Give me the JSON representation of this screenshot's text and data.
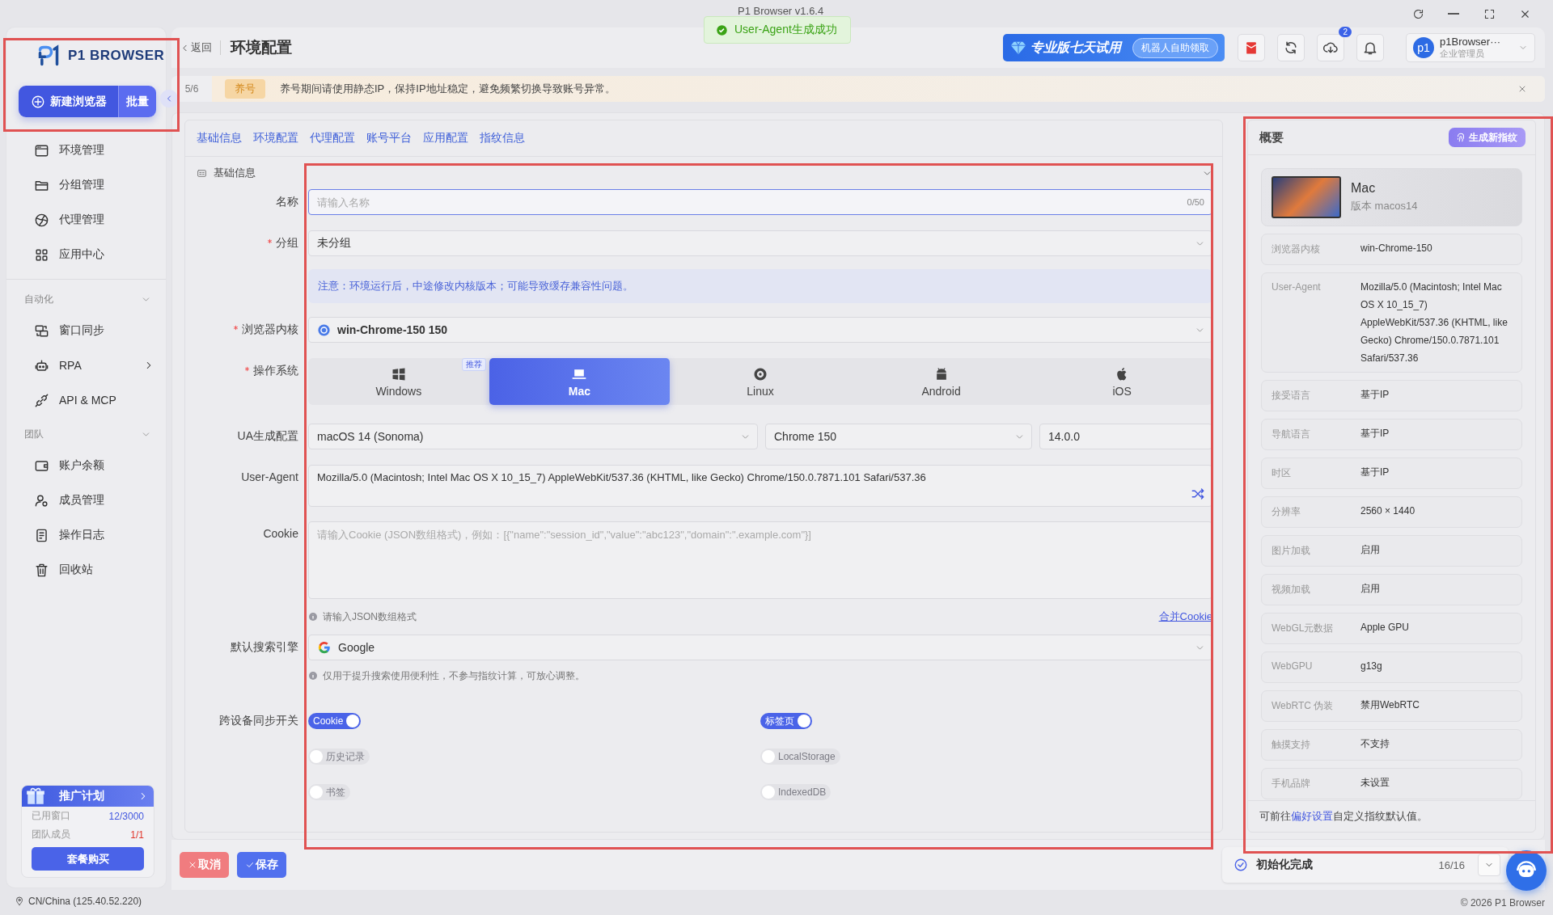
{
  "window": {
    "title": "P1 Browser v1.6.4"
  },
  "toast": {
    "kind": "success",
    "text": "User-Agent生成成功"
  },
  "sidebar": {
    "logo": "P1 BROWSER",
    "new_button": "新建浏览器",
    "batch_button": "批量",
    "sections": [
      {
        "items": [
          {
            "label": "环境管理",
            "selected": false,
            "submenu": false
          },
          {
            "label": "分组管理",
            "selected": false,
            "submenu": false
          },
          {
            "label": "代理管理",
            "selected": false,
            "submenu": false
          },
          {
            "label": "应用中心",
            "selected": false,
            "submenu": false
          }
        ]
      },
      {
        "title": "自动化",
        "expanded": true,
        "items": [
          {
            "label": "窗口同步",
            "selected": false,
            "submenu": false
          },
          {
            "label": "RPA",
            "selected": false,
            "submenu": true
          },
          {
            "label": "API & MCP",
            "selected": false,
            "submenu": false
          }
        ]
      },
      {
        "title": "团队",
        "expanded": true,
        "items": [
          {
            "label": "账户余额",
            "selected": false,
            "submenu": false
          },
          {
            "label": "成员管理",
            "selected": false,
            "submenu": false
          },
          {
            "label": "操作日志",
            "selected": false,
            "submenu": false
          },
          {
            "label": "回收站",
            "selected": false,
            "submenu": false
          }
        ]
      }
    ],
    "promo": {
      "title": "推广计划",
      "rows": [
        {
          "kind": "info",
          "label": "已用窗口",
          "value": "12/3000"
        },
        {
          "kind": "warn",
          "label": "团队成员",
          "value": "1/1"
        }
      ],
      "button": "套餐购买"
    },
    "location": "CN/China (125.40.52.220)"
  },
  "header": {
    "back": "返回",
    "title": "环境配置",
    "trial": "专业版七天试用",
    "trial_button": "机器人自助领取",
    "download_badge": "2",
    "user": {
      "avatar": "p1",
      "name": "p1Browser···",
      "role": "企业管理员"
    }
  },
  "notice": {
    "counter": "5/6",
    "tag": "养号",
    "text": "养号期间请使用静态IP，保持IP地址稳定，避免频繁切换导致账号异常。"
  },
  "tabs": [
    "基础信息",
    "环境配置",
    "代理配置",
    "账号平台",
    "应用配置",
    "指纹信息"
  ],
  "form": {
    "section": "基础信息",
    "name": {
      "label": "名称",
      "required": false,
      "placeholder": "请输入名称",
      "counter": "0/50"
    },
    "group": {
      "label": "分组",
      "required": true,
      "value": "未分组"
    },
    "note": "注意：环境运行后，中途修改内核版本；可能导致缓存兼容性问题。",
    "kernel": {
      "label": "浏览器内核",
      "required": true,
      "value": "win-Chrome-150 150"
    },
    "os": {
      "label": "操作系统",
      "required": true,
      "options": [
        {
          "label": "Windows",
          "selected": false,
          "badge": "推荐"
        },
        {
          "label": "Mac",
          "selected": true
        },
        {
          "label": "Linux",
          "selected": false
        },
        {
          "label": "Android",
          "selected": false
        },
        {
          "label": "iOS",
          "selected": false
        }
      ]
    },
    "ua_config": {
      "label": "UA生成配置",
      "required": false,
      "os": "macOS 14 (Sonoma)",
      "browser": "Chrome 150",
      "version": "14.0.0"
    },
    "user_agent": {
      "label": "User-Agent",
      "required": false,
      "value": "Mozilla/5.0 (Macintosh; Intel Mac OS X 10_15_7) AppleWebKit/537.36 (KHTML, like Gecko) Chrome/150.0.7871.101 Safari/537.36"
    },
    "cookie": {
      "label": "Cookie",
      "required": false,
      "placeholder": "请输入Cookie (JSON数组格式)，例如：[{\"name\":\"session_id\",\"value\":\"abc123\",\"domain\":\".example.com\"}]",
      "hint": "请输入JSON数组格式",
      "merge_link": "合并Cookie"
    },
    "search_engine": {
      "label": "默认搜索引擎",
      "required": false,
      "value": "Google",
      "hint": "仅用于提升搜索使用便利性，不参与指纹计算，可放心调整。"
    },
    "sync": {
      "label": "跨设备同步开关",
      "toggles": [
        {
          "label": "Cookie",
          "on": true
        },
        {
          "label": "标签页",
          "on": true
        },
        {
          "label": "历史记录",
          "on": false
        },
        {
          "label": "LocalStorage",
          "on": false
        },
        {
          "label": "书签",
          "on": false
        },
        {
          "label": "IndexedDB",
          "on": false
        }
      ]
    }
  },
  "summary": {
    "title": "概要",
    "button": "生成新指纹",
    "device": {
      "name": "Mac",
      "version": "版本 macos14"
    },
    "rows": [
      {
        "label": "浏览器内核",
        "value": "win-Chrome-150"
      },
      {
        "label": "User-Agent",
        "value": "Mozilla/5.0 (Macintosh; Intel Mac OS X 10_15_7) AppleWebKit/537.36 (KHTML, like Gecko) Chrome/150.0.7871.101 Safari/537.36"
      },
      {
        "label": "接受语言",
        "value": "基于IP"
      },
      {
        "label": "导航语言",
        "value": "基于IP"
      },
      {
        "label": "时区",
        "value": "基于IP"
      },
      {
        "label": "分辨率",
        "value": "2560 × 1440"
      },
      {
        "label": "图片加载",
        "value": "启用"
      },
      {
        "label": "视频加载",
        "value": "启用"
      },
      {
        "label": "WebGL元数据",
        "value": "Apple GPU"
      },
      {
        "label": "WebGPU",
        "value": "g13g"
      },
      {
        "label": "WebRTC 伪装",
        "value": "禁用WebRTC"
      },
      {
        "label": "触摸支持",
        "value": "不支持"
      },
      {
        "label": "手机品牌",
        "value": "未设置"
      }
    ],
    "footer": {
      "before": "可前往",
      "link": "偏好设置",
      "after": "自定义指纹默认值。"
    }
  },
  "actions": {
    "cancel": "取消",
    "save": "保存"
  },
  "status": {
    "text": "初始化完成",
    "count": "16/16"
  },
  "copyright": "© 2026 P1 Browser"
}
